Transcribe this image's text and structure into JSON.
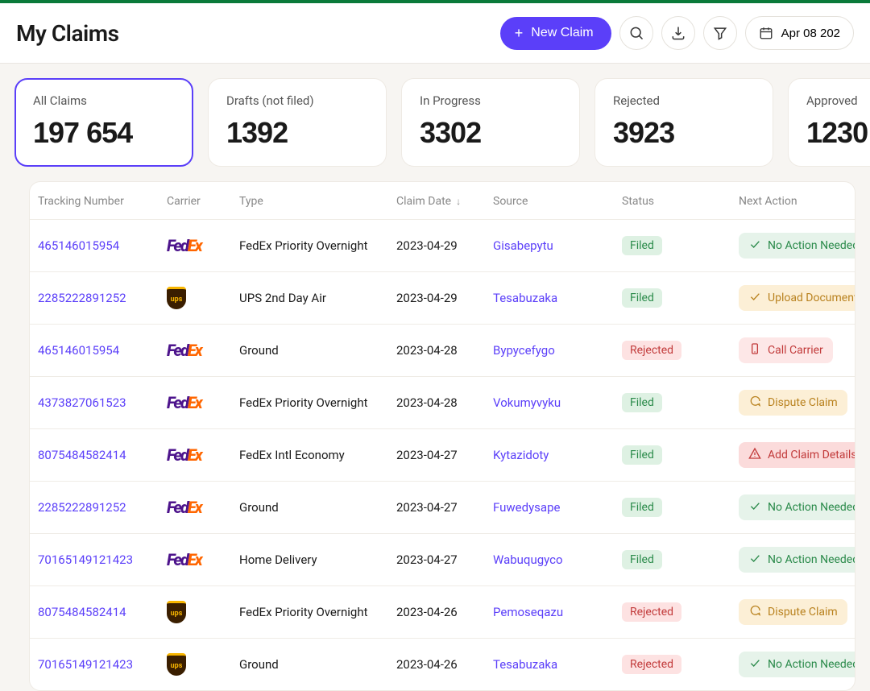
{
  "header": {
    "title": "My Claims",
    "new_claim_label": "New Claim",
    "date_label": "Apr 08 202"
  },
  "stats": [
    {
      "label": "All Claims",
      "value": "197 654",
      "active": true
    },
    {
      "label": "Drafts (not filed)",
      "value": "1392",
      "active": false
    },
    {
      "label": "In Progress",
      "value": "3302",
      "active": false
    },
    {
      "label": "Rejected",
      "value": "3923",
      "active": false
    },
    {
      "label": "Approved",
      "value": "1230",
      "active": false
    }
  ],
  "columns": {
    "tracking": "Tracking Number",
    "carrier": "Carrier",
    "type": "Type",
    "claim_date": "Claim Date",
    "source": "Source",
    "status": "Status",
    "next_action": "Next Action"
  },
  "status_labels": {
    "filed": "Filed",
    "rejected": "Rejected"
  },
  "action_labels": {
    "none": "No Action Needed",
    "upload": "Upload Documents",
    "call": "Call Carrier",
    "dispute": "Dispute Claim",
    "adddetails": "Add Claim Details"
  },
  "rows": [
    {
      "tracking": "465146015954",
      "carrier": "fedex",
      "type": "FedEx Priority Overnight",
      "date": "2023-04-29",
      "source": "Gisabepytu",
      "status": "filed",
      "action": "none"
    },
    {
      "tracking": "2285222891252",
      "carrier": "ups",
      "type": "UPS 2nd Day Air",
      "date": "2023-04-29",
      "source": "Tesabuzaka",
      "status": "filed",
      "action": "upload"
    },
    {
      "tracking": "465146015954",
      "carrier": "fedex",
      "type": "Ground",
      "date": "2023-04-28",
      "source": "Bypycefygo",
      "status": "rejected",
      "action": "call"
    },
    {
      "tracking": "4373827061523",
      "carrier": "fedex",
      "type": "FedEx Priority Overnight",
      "date": "2023-04-28",
      "source": "Vokumyvyku",
      "status": "filed",
      "action": "dispute"
    },
    {
      "tracking": "8075484582414",
      "carrier": "fedex",
      "type": "FedEx Intl Economy",
      "date": "2023-04-27",
      "source": "Kytazidoty",
      "status": "filed",
      "action": "adddetails"
    },
    {
      "tracking": "2285222891252",
      "carrier": "fedex",
      "type": "Ground",
      "date": "2023-04-27",
      "source": "Fuwedysape",
      "status": "filed",
      "action": "none"
    },
    {
      "tracking": "70165149121423",
      "carrier": "fedex",
      "type": "Home Delivery",
      "date": "2023-04-27",
      "source": "Wabuqugyco",
      "status": "filed",
      "action": "none"
    },
    {
      "tracking": "8075484582414",
      "carrier": "ups",
      "type": "FedEx Priority Overnight",
      "date": "2023-04-26",
      "source": "Pemoseqazu",
      "status": "rejected",
      "action": "dispute"
    },
    {
      "tracking": "70165149121423",
      "carrier": "ups",
      "type": "Ground",
      "date": "2023-04-26",
      "source": "Tesabuzaka",
      "status": "rejected",
      "action": "none"
    }
  ]
}
